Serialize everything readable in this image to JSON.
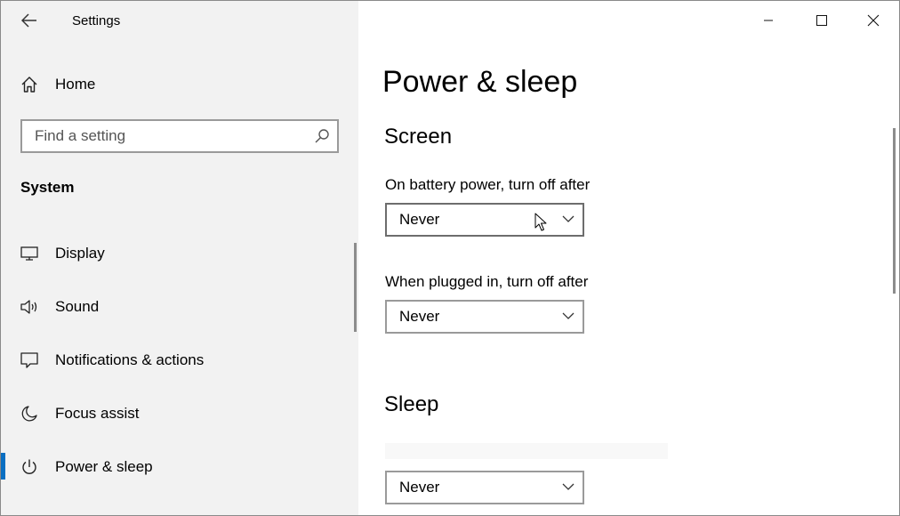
{
  "window": {
    "title": "Settings"
  },
  "sidebar": {
    "home_label": "Home",
    "search": {
      "placeholder": "Find a setting",
      "value": ""
    },
    "section_heading": "System",
    "items": [
      {
        "id": "display",
        "label": "Display",
        "icon": "monitor-icon"
      },
      {
        "id": "sound",
        "label": "Sound",
        "icon": "speaker-icon"
      },
      {
        "id": "notifications",
        "label": "Notifications & actions",
        "icon": "notification-icon"
      },
      {
        "id": "focus",
        "label": "Focus assist",
        "icon": "moon-icon"
      },
      {
        "id": "power",
        "label": "Power & sleep",
        "icon": "power-icon",
        "selected": true
      }
    ]
  },
  "main": {
    "page_title": "Power & sleep",
    "screen": {
      "title": "Screen",
      "battery_label": "On battery power, turn off after",
      "battery_value": "Never",
      "plugged_label": "When plugged in, turn off after",
      "plugged_value": "Never"
    },
    "sleep": {
      "title": "Sleep",
      "value": "Never"
    }
  },
  "colors": {
    "sidebar_bg": "#f2f2f2",
    "accent": "#0a6fc2",
    "border": "#9a9a9a"
  }
}
